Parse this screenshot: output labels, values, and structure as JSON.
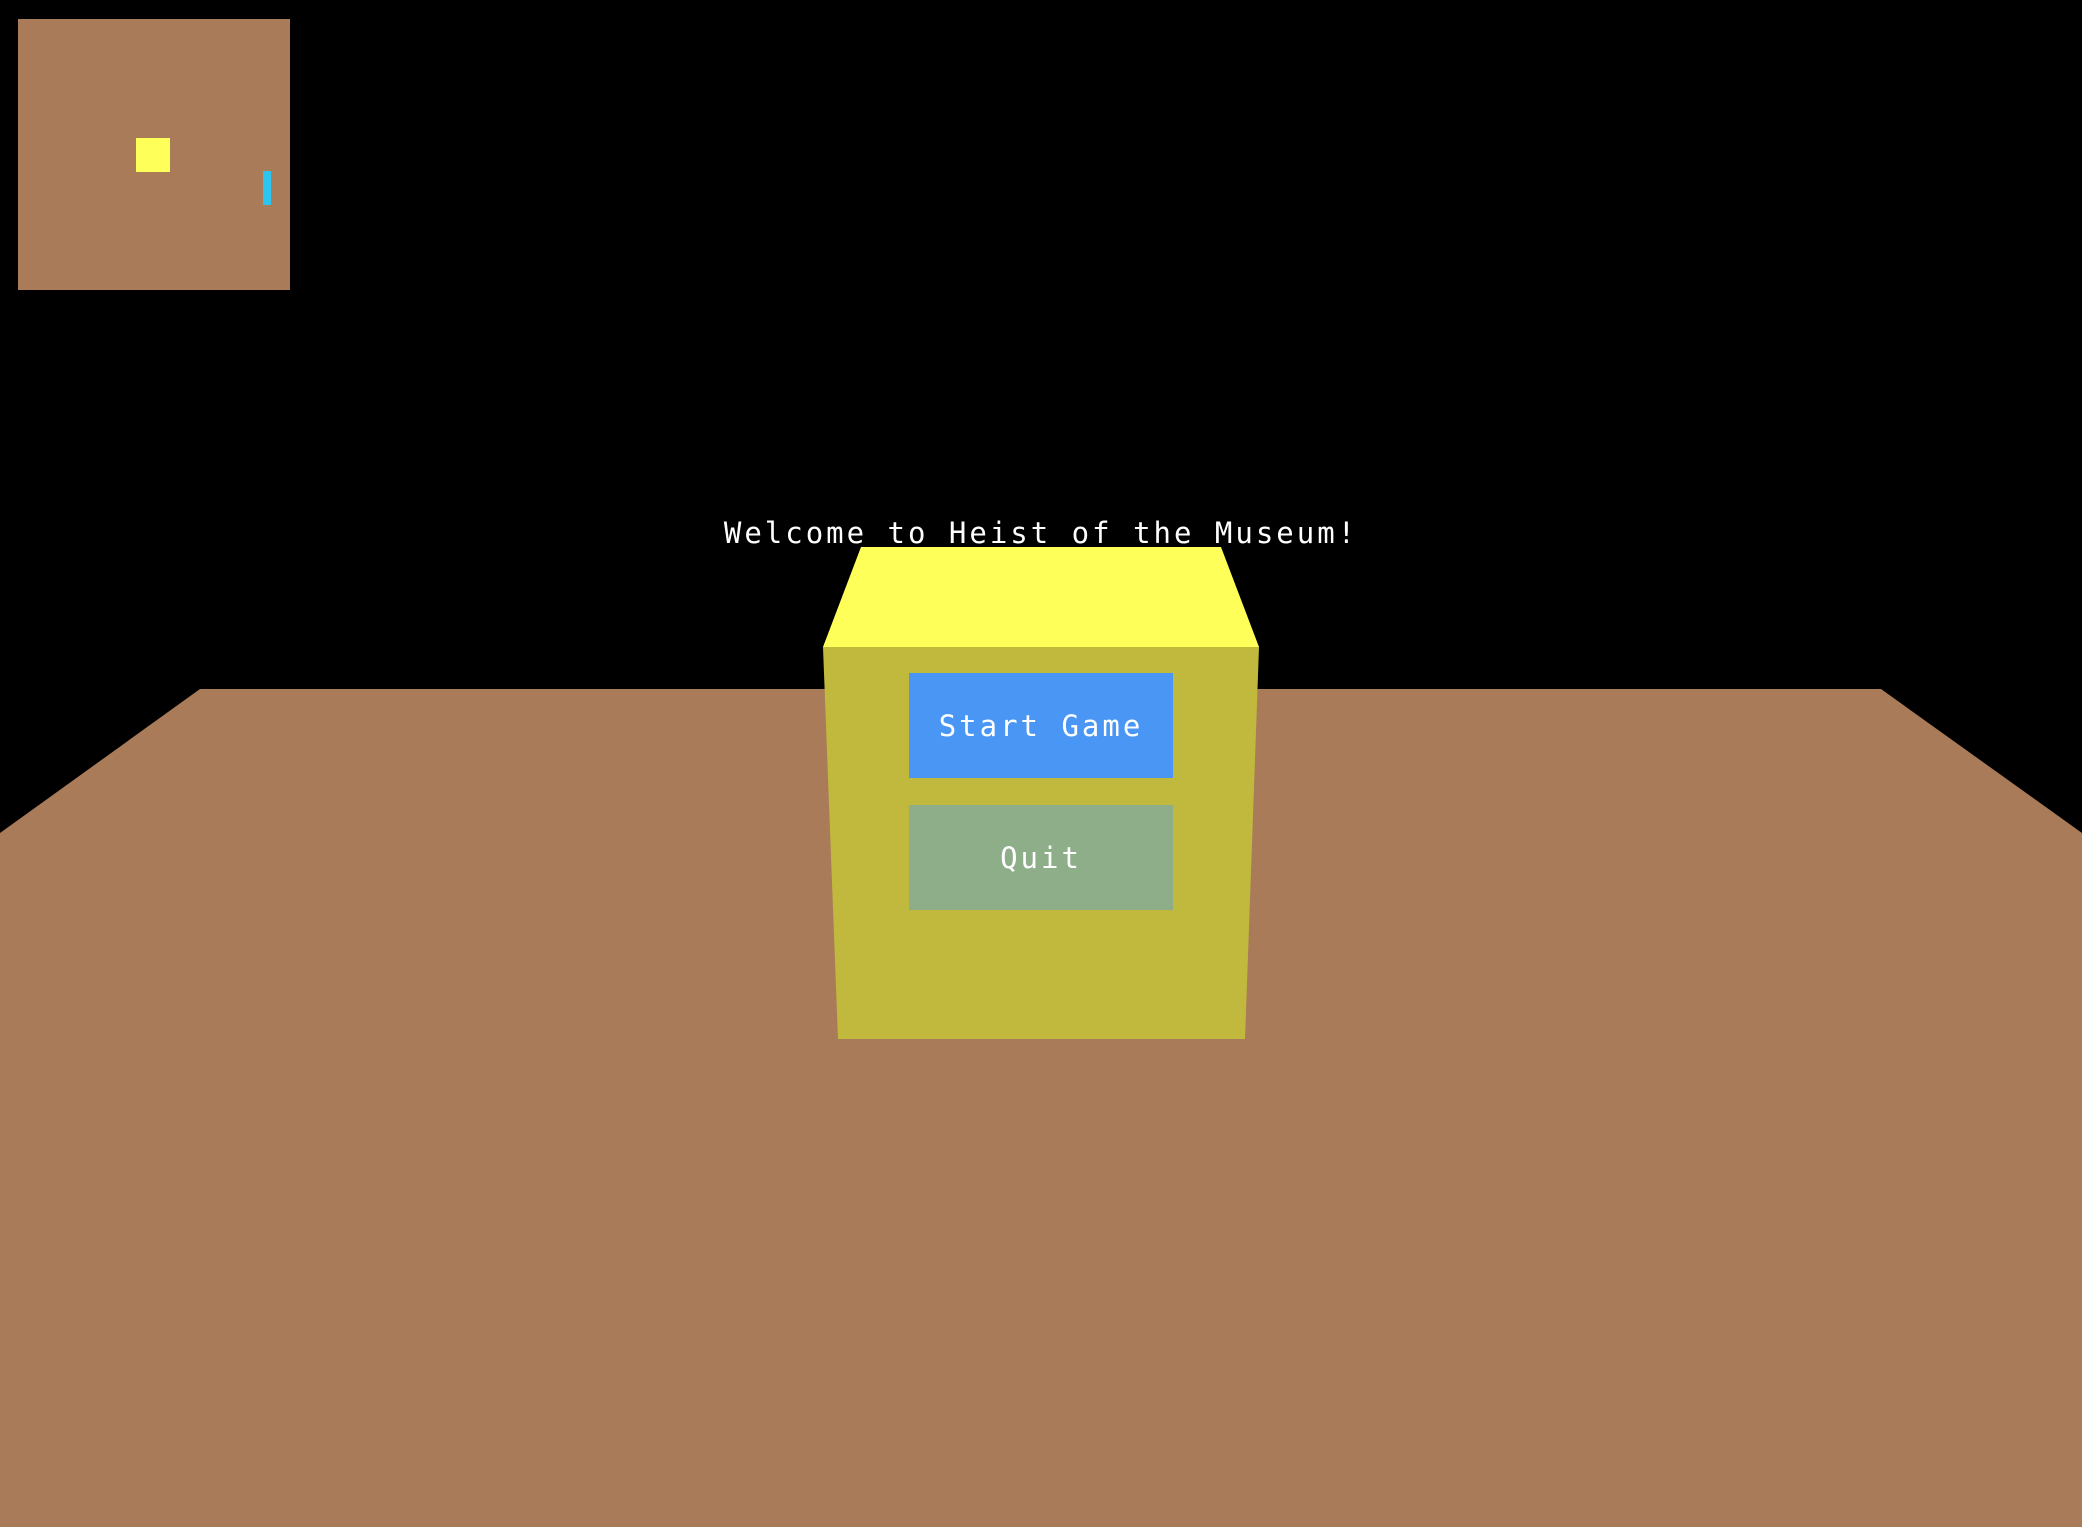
{
  "game": {
    "welcome_text": "Welcome to Heist of the Museum!",
    "menu": {
      "start_label": "Start Game",
      "quit_label": "Quit"
    }
  },
  "colors": {
    "sky": "#000000",
    "floor": "#a97b58",
    "cube_top": "#ffff59",
    "cube_front": "#c1b93e",
    "start_button": "#4a96f5",
    "quit_button": "#8eae8a",
    "text": "#ffffff",
    "minimap_background": "#a97b58",
    "minimap_exhibit": "#ffff59",
    "minimap_player": "#2ec4f0"
  }
}
